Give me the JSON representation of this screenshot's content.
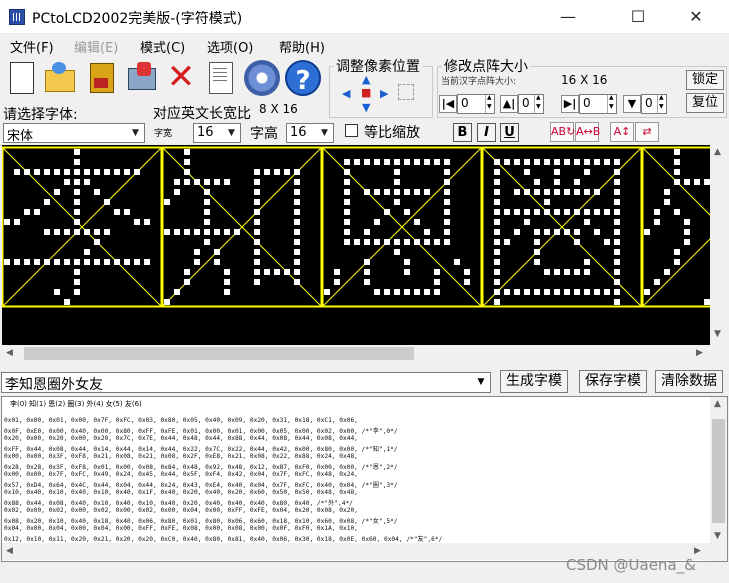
{
  "window": {
    "title": "PCtoLCD2002完美版-(字符模式)",
    "min_glyph": "—",
    "max_glyph": "☐",
    "close_glyph": "✕"
  },
  "menu": [
    "文件(F)",
    "编辑(E)",
    "模式(C)",
    "选项(O)",
    "帮助(H)"
  ],
  "toolbar": {
    "icons": [
      "new-document-icon",
      "open-folder-icon",
      "save-icon",
      "font-image-icon",
      "delete-x-icon",
      "text-page-icon",
      "settings-gear-icon",
      "help-icon"
    ],
    "x_glyph": "✕",
    "help_glyph": "?"
  },
  "pixel_adjust": {
    "title": "调整像素位置",
    "arrows": [
      "▲",
      "◀",
      "▶",
      "▼",
      "■"
    ]
  },
  "dot_size": {
    "title": "修改点阵大小",
    "current_label": "当前汉字点阵大小:",
    "current_value": "16 X 16",
    "spinners": [
      {
        "icon": "|◀",
        "value": "0"
      },
      {
        "icon": "▲|",
        "value": "0"
      },
      {
        "icon": "▶|",
        "value": "0"
      },
      {
        "icon": "▼",
        "value": "0"
      }
    ],
    "lock_label": "锁定",
    "reset_label": "复位"
  },
  "font": {
    "select_label": "请选择字体:",
    "font_value": "宋体",
    "ascii_ratio_label": "对应英文长宽比",
    "ascii_ratio_value": "8 X 16",
    "width_label": "字宽",
    "width_value": "16",
    "height_label": "字高",
    "height_value": "16",
    "proportional_label": "等比缩放",
    "bold": "B",
    "italic": "I",
    "underline": "U",
    "rotate_glyphs": [
      "AB↻",
      "A↔B",
      "A↕",
      "⇄"
    ]
  },
  "input": {
    "text": "李知恩圈外女友"
  },
  "actions": {
    "generate": "生成字模",
    "save": "保存字模",
    "clear": "清除数据"
  },
  "output": {
    "header": "李(0) 知(1) 恩(2) 圈(3) 外(4) 女(5) 友(6)",
    "lines": [
      "0x01, 0x00, 0x01, 0x00, 0x7F, 0xFC, 0x03, 0x80, 0x05, 0x40, 0x09, 0x20, 0x31, 0x18, 0xC1, 0x06,",
      "0x0F, 0xE0, 0x00, 0x40, 0x00, 0x80, 0xFF, 0xFE, 0x01, 0x00, 0x01, 0x00, 0x05, 0x00, 0x02, 0x00, /*\"李\",0*/",
      "0x20, 0x00, 0x20, 0x00, 0x20, 0x7C, 0x7E, 0x44, 0x48, 0x44, 0x88, 0x44, 0x08, 0x44, 0x08, 0x44,",
      "0xFF, 0x44, 0x08, 0x44, 0x14, 0x44, 0x14, 0x44, 0x22, 0x7C, 0x22, 0x44, 0x42, 0x00, 0x80, 0x00, /*\"知\",1*/",
      "0x00, 0x00, 0x3F, 0xF8, 0x21, 0x08, 0x21, 0x08, 0x2F, 0xE8, 0x21, 0x08, 0x22, 0x88, 0x24, 0x48,",
      "0x28, 0x28, 0x3F, 0xF8, 0x01, 0x00, 0x08, 0x84, 0x48, 0x92, 0x48, 0x12, 0x87, 0xF0, 0x00, 0x00, /*\"恩\",2*/",
      "0x00, 0x00, 0x7F, 0xFC, 0x49, 0x24, 0x45, 0x44, 0x5F, 0xF4, 0x42, 0x04, 0x7F, 0xFC, 0x48, 0x24,",
      "0x57, 0xD4, 0x64, 0x4C, 0x44, 0x04, 0x44, 0x24, 0x43, 0xE4, 0x40, 0x04, 0x7F, 0xFC, 0x40, 0x04, /*\"圈\",3*/",
      "0x10, 0x40, 0x10, 0x40, 0x10, 0x40, 0x1F, 0x40, 0x20, 0x40, 0x20, 0x60, 0x50, 0x50, 0x48, 0x48,",
      "0x88, 0x44, 0x08, 0x40, 0x10, 0x40, 0x10, 0x40, 0x20, 0x40, 0x40, 0x40, 0x80, 0x40, /*\"外\",4*/",
      "0x02, 0x00, 0x02, 0x00, 0x02, 0x00, 0x02, 0x00, 0x04, 0x00, 0xFF, 0xFE, 0x04, 0x20, 0x08, 0x20,",
      "0x08, 0x20, 0x10, 0x40, 0x18, 0x40, 0x06, 0x80, 0x01, 0x80, 0x06, 0x60, 0x18, 0x10, 0x60, 0x08, /*\"女\",5*/",
      "0x04, 0x00, 0x04, 0x00, 0x04, 0x00, 0xFF, 0xFE, 0x08, 0x00, 0x08, 0x00, 0x0F, 0xF0, 0x1A, 0x10,",
      "0x12, 0x10, 0x11, 0x20, 0x21, 0x20, 0x20, 0xC0, 0x40, 0x80, 0x81, 0x40, 0x06, 0x30, 0x18, 0x0E, 0x60, 0x04, /*\"友\",6*/"
    ]
  },
  "watermark": "CSDN @Uaena_&",
  "colors": {
    "canvas_bg": "#000000",
    "pixel": "#ffffff",
    "grid": "#ffff00"
  }
}
